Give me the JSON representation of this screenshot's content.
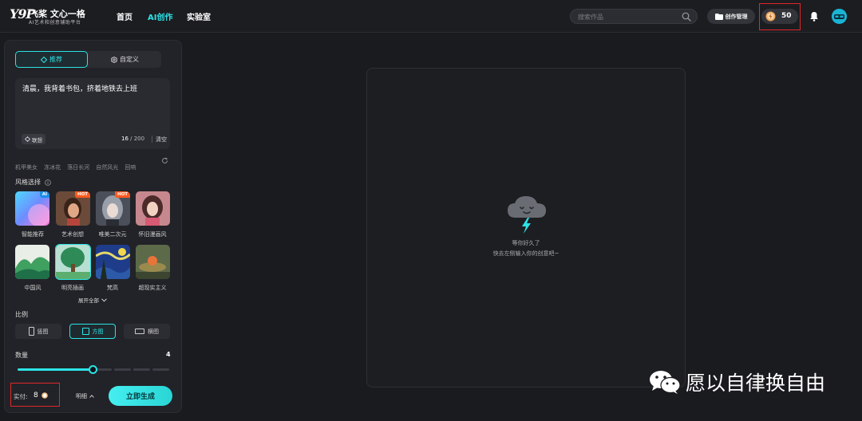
{
  "brand": {
    "mark": "Y9P",
    "name": "飞桨 文心一格",
    "tagline": "AI艺术和创意辅助平台"
  },
  "nav": [
    {
      "label": "首页",
      "active": false
    },
    {
      "label": "AI创作",
      "active": true
    },
    {
      "label": "实验室",
      "active": false
    }
  ],
  "header": {
    "search_placeholder": "搜索作品",
    "mgmt_label": "创作管理",
    "credits": "50"
  },
  "panel": {
    "tabs": [
      {
        "label": "推荐",
        "active": true
      },
      {
        "label": "自定义",
        "active": false
      }
    ],
    "prompt": "清晨，我背着书包，挤着地铁去上班",
    "assoc_label": "联想",
    "char_count": "16",
    "char_max": " / 200",
    "clear_label": "清空",
    "suggestions": [
      "机甲美女",
      "冻冰花",
      "落日长河",
      "自然风光",
      "回响"
    ],
    "style_title": "风格选择",
    "styles": [
      {
        "label": "智能推荐",
        "badge": "AI",
        "selected": false
      },
      {
        "label": "艺术创想",
        "badge": "HOT",
        "selected": false
      },
      {
        "label": "唯美二次元",
        "badge": "HOT",
        "selected": false
      },
      {
        "label": "怀旧漫画风",
        "badge": "",
        "selected": false
      },
      {
        "label": "中国风",
        "badge": "",
        "selected": false
      },
      {
        "label": "明亮插画",
        "badge": "",
        "selected": true
      },
      {
        "label": "梵高",
        "badge": "",
        "selected": false
      },
      {
        "label": "超现实主义",
        "badge": "",
        "selected": false
      }
    ],
    "expand_label": "展开全部",
    "ratio_title": "比例",
    "ratios": [
      {
        "label": "竖图",
        "active": false
      },
      {
        "label": "方图",
        "active": true
      },
      {
        "label": "横图",
        "active": false
      }
    ],
    "qty_title": "数量",
    "qty_value": "4",
    "qty_max": 8,
    "cost_label": "实付:",
    "cost_value": "8",
    "detail_label": "明细",
    "generate_label": "立即生成"
  },
  "canvas": {
    "empty_line1": "等你好久了",
    "empty_line2": "快去左侧输入你的创意吧~"
  },
  "watermark": "愿以自律换自由",
  "colors": {
    "accent": "#2ce3e6",
    "highlight_box": "#e0262a",
    "hot_badge": "#ff5a1f",
    "ai_badge": "#1a8de9"
  }
}
